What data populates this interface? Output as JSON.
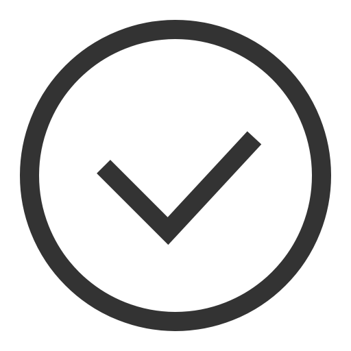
{
  "icon": {
    "name": "check-circle-icon",
    "stroke_color": "#333333",
    "background_color": "#ffffff"
  }
}
